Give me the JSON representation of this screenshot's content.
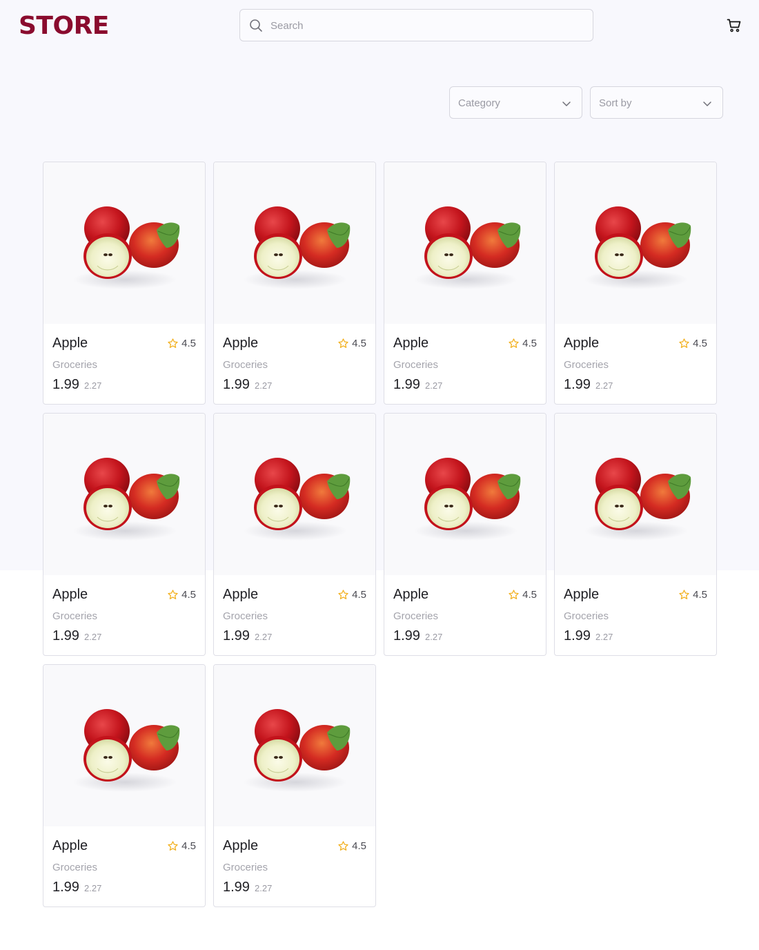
{
  "header": {
    "logo": "STORE",
    "search_placeholder": "Search"
  },
  "filters": {
    "category_label": "Category",
    "sort_label": "Sort by"
  },
  "colors": {
    "brand": "#8a0b2e",
    "star": "#f2b01e"
  },
  "icons": [
    "search-icon",
    "cart-icon",
    "chevron-down-icon",
    "star-icon"
  ],
  "products": [
    {
      "name": "Apple",
      "rating": "4.5",
      "category": "Groceries",
      "price": "1.99",
      "old_price": "2.27"
    },
    {
      "name": "Apple",
      "rating": "4.5",
      "category": "Groceries",
      "price": "1.99",
      "old_price": "2.27"
    },
    {
      "name": "Apple",
      "rating": "4.5",
      "category": "Groceries",
      "price": "1.99",
      "old_price": "2.27"
    },
    {
      "name": "Apple",
      "rating": "4.5",
      "category": "Groceries",
      "price": "1.99",
      "old_price": "2.27"
    },
    {
      "name": "Apple",
      "rating": "4.5",
      "category": "Groceries",
      "price": "1.99",
      "old_price": "2.27"
    },
    {
      "name": "Apple",
      "rating": "4.5",
      "category": "Groceries",
      "price": "1.99",
      "old_price": "2.27"
    },
    {
      "name": "Apple",
      "rating": "4.5",
      "category": "Groceries",
      "price": "1.99",
      "old_price": "2.27"
    },
    {
      "name": "Apple",
      "rating": "4.5",
      "category": "Groceries",
      "price": "1.99",
      "old_price": "2.27"
    },
    {
      "name": "Apple",
      "rating": "4.5",
      "category": "Groceries",
      "price": "1.99",
      "old_price": "2.27"
    },
    {
      "name": "Apple",
      "rating": "4.5",
      "category": "Groceries",
      "price": "1.99",
      "old_price": "2.27"
    }
  ]
}
